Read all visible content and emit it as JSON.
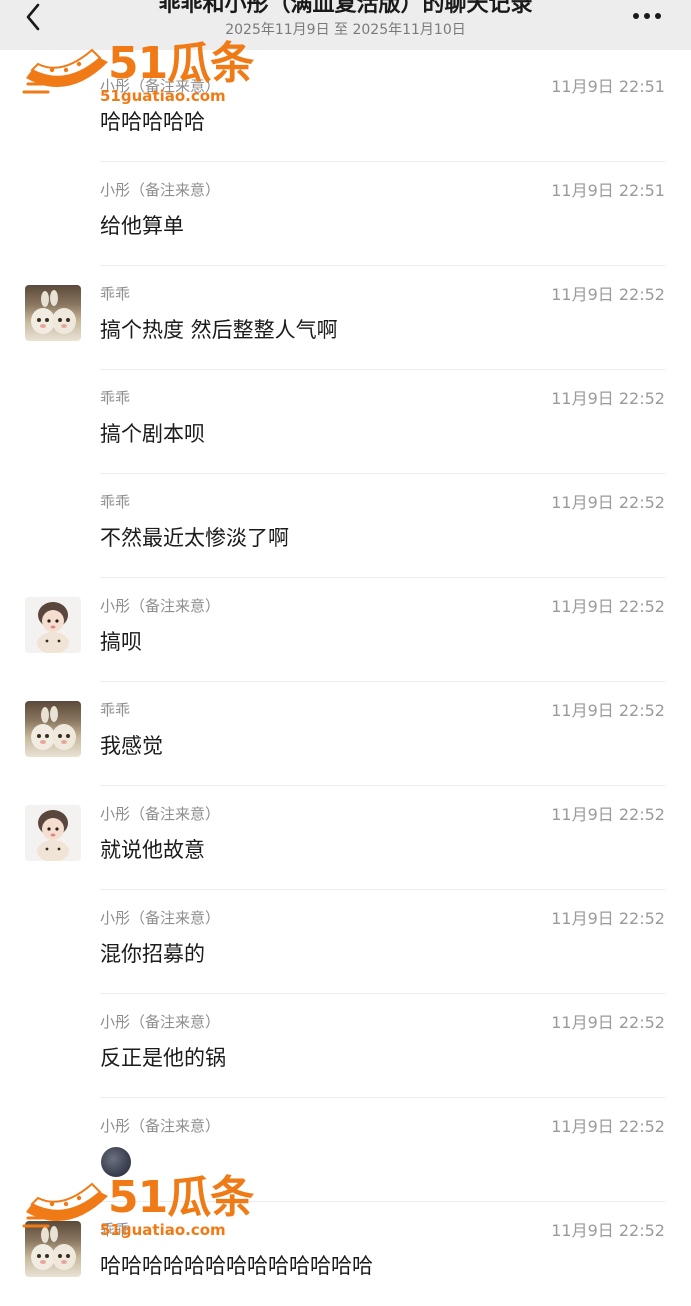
{
  "header": {
    "title": "乖乖和小彤（满血复活版）的聊天记录",
    "subtitle": "2025年11月9日 至 2025年11月10日"
  },
  "icons": {
    "back": "chevron-left-icon",
    "more": "more-horizontal-icon"
  },
  "messages": [
    {
      "sender": "小彤（备注来意）",
      "time": "11月9日 22:51",
      "text": "哈哈哈哈哈",
      "avatar": ""
    },
    {
      "sender": "小彤（备注来意）",
      "time": "11月9日 22:51",
      "text": "给他算单",
      "avatar": ""
    },
    {
      "sender": "乖乖",
      "time": "11月9日 22:52",
      "text": "搞个热度 然后整整人气啊",
      "avatar": "guaiguai"
    },
    {
      "sender": "乖乖",
      "time": "11月9日 22:52",
      "text": "搞个剧本呗",
      "avatar": ""
    },
    {
      "sender": "乖乖",
      "time": "11月9日 22:52",
      "text": "不然最近太惨淡了啊",
      "avatar": ""
    },
    {
      "sender": "小彤（备注来意）",
      "time": "11月9日 22:52",
      "text": "搞呗",
      "avatar": "xiaotong"
    },
    {
      "sender": "乖乖",
      "time": "11月9日 22:52",
      "text": "我感觉",
      "avatar": "guaiguai"
    },
    {
      "sender": "小彤（备注来意）",
      "time": "11月9日 22:52",
      "text": "就说他故意",
      "avatar": "xiaotong"
    },
    {
      "sender": "小彤（备注来意）",
      "time": "11月9日 22:52",
      "text": "混你招募的",
      "avatar": ""
    },
    {
      "sender": "小彤（备注来意）",
      "time": "11月9日 22:52",
      "text": "反正是他的锅",
      "avatar": ""
    },
    {
      "sender": "小彤（备注来意）",
      "time": "11月9日 22:52",
      "text": "",
      "avatar": ""
    },
    {
      "sender": "乖乖",
      "time": "11月9日 22:52",
      "text": "哈哈哈哈哈哈哈哈哈哈哈哈哈",
      "avatar": "guaiguai"
    }
  ],
  "watermark": {
    "brand": "51瓜条",
    "url": "51guatiao.com",
    "color": "#f07a16"
  }
}
